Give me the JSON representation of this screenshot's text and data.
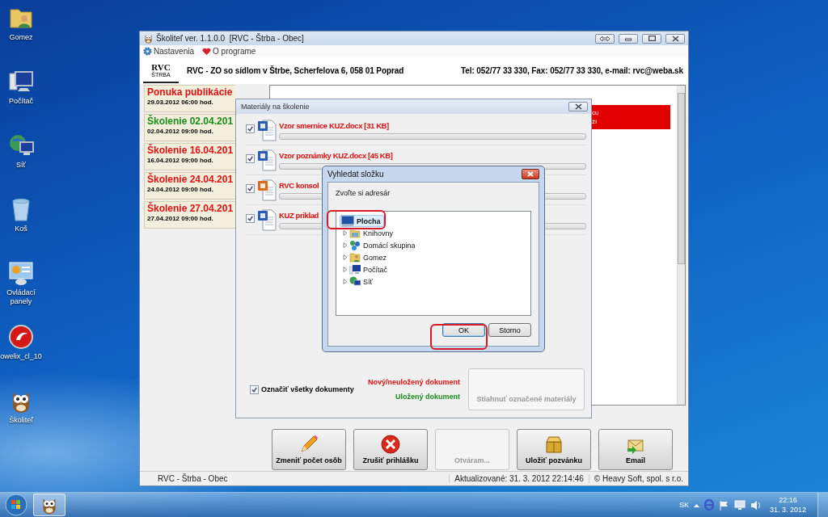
{
  "desktop_icons": [
    {
      "label": "Gomez",
      "kind": "user-folder"
    },
    {
      "label": "Počítač",
      "kind": "computer"
    },
    {
      "label": "Síť",
      "kind": "network"
    },
    {
      "label": "Koš",
      "kind": "bin"
    },
    {
      "label": "Ovládací panely",
      "kind": "control-panel"
    },
    {
      "label": "owelix_cl_10",
      "kind": "red-app"
    },
    {
      "label": "Školiteľ",
      "kind": "owl"
    }
  ],
  "main_window": {
    "title": "Školiteľ ver. 1.1.0.0  [RVC - Štrba - Obec]",
    "menu": [
      {
        "label": "Nastavenia",
        "kind": "gear"
      },
      {
        "label": "O programe",
        "kind": "heart"
      }
    ],
    "logo": {
      "text": "RVC",
      "subtext": "ŠTRBA"
    },
    "header_address": "RVC - ZO so sídlom v Štrbe, Scherfelova 6, 058 01 Poprad",
    "header_contact": "Tel: 052/77 33 330, Fax: 052/77 33 330, e-mail: rvc@weba.sk",
    "events": [
      {
        "title": "Ponuka publikácie",
        "date": "29.03.2012 06:00 hod.",
        "color": "#e01010"
      },
      {
        "title": "Školenie 02.04.201",
        "date": "02.04.2012 09:00 hod.",
        "color": "#1a8c1a"
      },
      {
        "title": "Školenie 16.04.201",
        "date": "16.04.2012 09:00 hod.",
        "color": "#e01010"
      },
      {
        "title": "Školenie 24.04.201",
        "date": "24.04.2012 09:00 hod.",
        "color": "#e01010"
      },
      {
        "title": "Školenie 27.04.201",
        "date": "27.04.2012 09:00 hod.",
        "color": "#e01010"
      }
    ],
    "alert_lines": [
      "cu",
      "ží"
    ],
    "actions": [
      {
        "label": "Zmeniť počet osôb",
        "kind": "pencil",
        "disabled": false
      },
      {
        "label": "Zrušiť prihlášku",
        "kind": "cancel",
        "disabled": false
      },
      {
        "label": "Otváram...",
        "kind": "plain",
        "disabled": true
      },
      {
        "label": "Uložiť pozvánku",
        "kind": "box",
        "disabled": false
      },
      {
        "label": "Email",
        "kind": "mail",
        "disabled": false
      }
    ],
    "status_bar": [
      "RVC - Štrba - Obec",
      "Aktualizované: 31. 3. 2012 22:14:46",
      "© Heavy Soft, spol. s r.o."
    ]
  },
  "materials_dialog": {
    "title": "Materiály na školenie",
    "items": [
      {
        "name": "Vzor smernice KUZ.docx [31 KB]",
        "kind": "word",
        "checked": true,
        "level": 0
      },
      {
        "name": "Vzor poznámky KUZ.docx [45 KB]",
        "kind": "word",
        "checked": true,
        "level": 0
      },
      {
        "name": "RVC konsol",
        "kind": "powerpoint",
        "checked": true,
        "level": 0
      },
      {
        "name": "KUZ priklad",
        "kind": "word",
        "checked": true,
        "level": 0
      }
    ],
    "select_all": {
      "label": "Označiť všetky dokumenty",
      "checked": true
    },
    "legend": [
      {
        "label": "Nový/neuložený dokument",
        "color": "#e01010"
      },
      {
        "label": "Uložený dokument",
        "color": "#1a8c1a"
      }
    ],
    "download_button": {
      "label": "Stiahnuť označené materiály",
      "disabled": true
    }
  },
  "folder_dialog": {
    "title": "Vyhledat složku",
    "prompt": "Zvoľte si adresár",
    "tree": [
      {
        "label": "Plocha",
        "kind": "desktop",
        "selected": true,
        "highlighted": true,
        "children": [
          {
            "label": "Knihovny",
            "kind": "library",
            "selected": false,
            "expanded": false,
            "highlighted": false
          },
          {
            "label": "Domácí skupina",
            "kind": "homegroup",
            "selected": false,
            "expanded": false,
            "highlighted": false
          },
          {
            "label": "Gomez",
            "kind": "user-folder",
            "selected": false,
            "expanded": false,
            "highlighted": false
          },
          {
            "label": "Počítač",
            "kind": "computer",
            "selected": false,
            "expanded": false,
            "highlighted": false
          },
          {
            "label": "Síť",
            "kind": "network",
            "selected": false,
            "expanded": false,
            "highlighted": false
          }
        ]
      }
    ],
    "buttons": [
      {
        "label": "OK",
        "kind": "default",
        "highlighted": true
      },
      {
        "label": "Storno",
        "kind": "normal",
        "highlighted": false
      }
    ]
  },
  "taskbar": {
    "language": "SK",
    "time": "22:16",
    "date": "31. 3. 2012"
  }
}
